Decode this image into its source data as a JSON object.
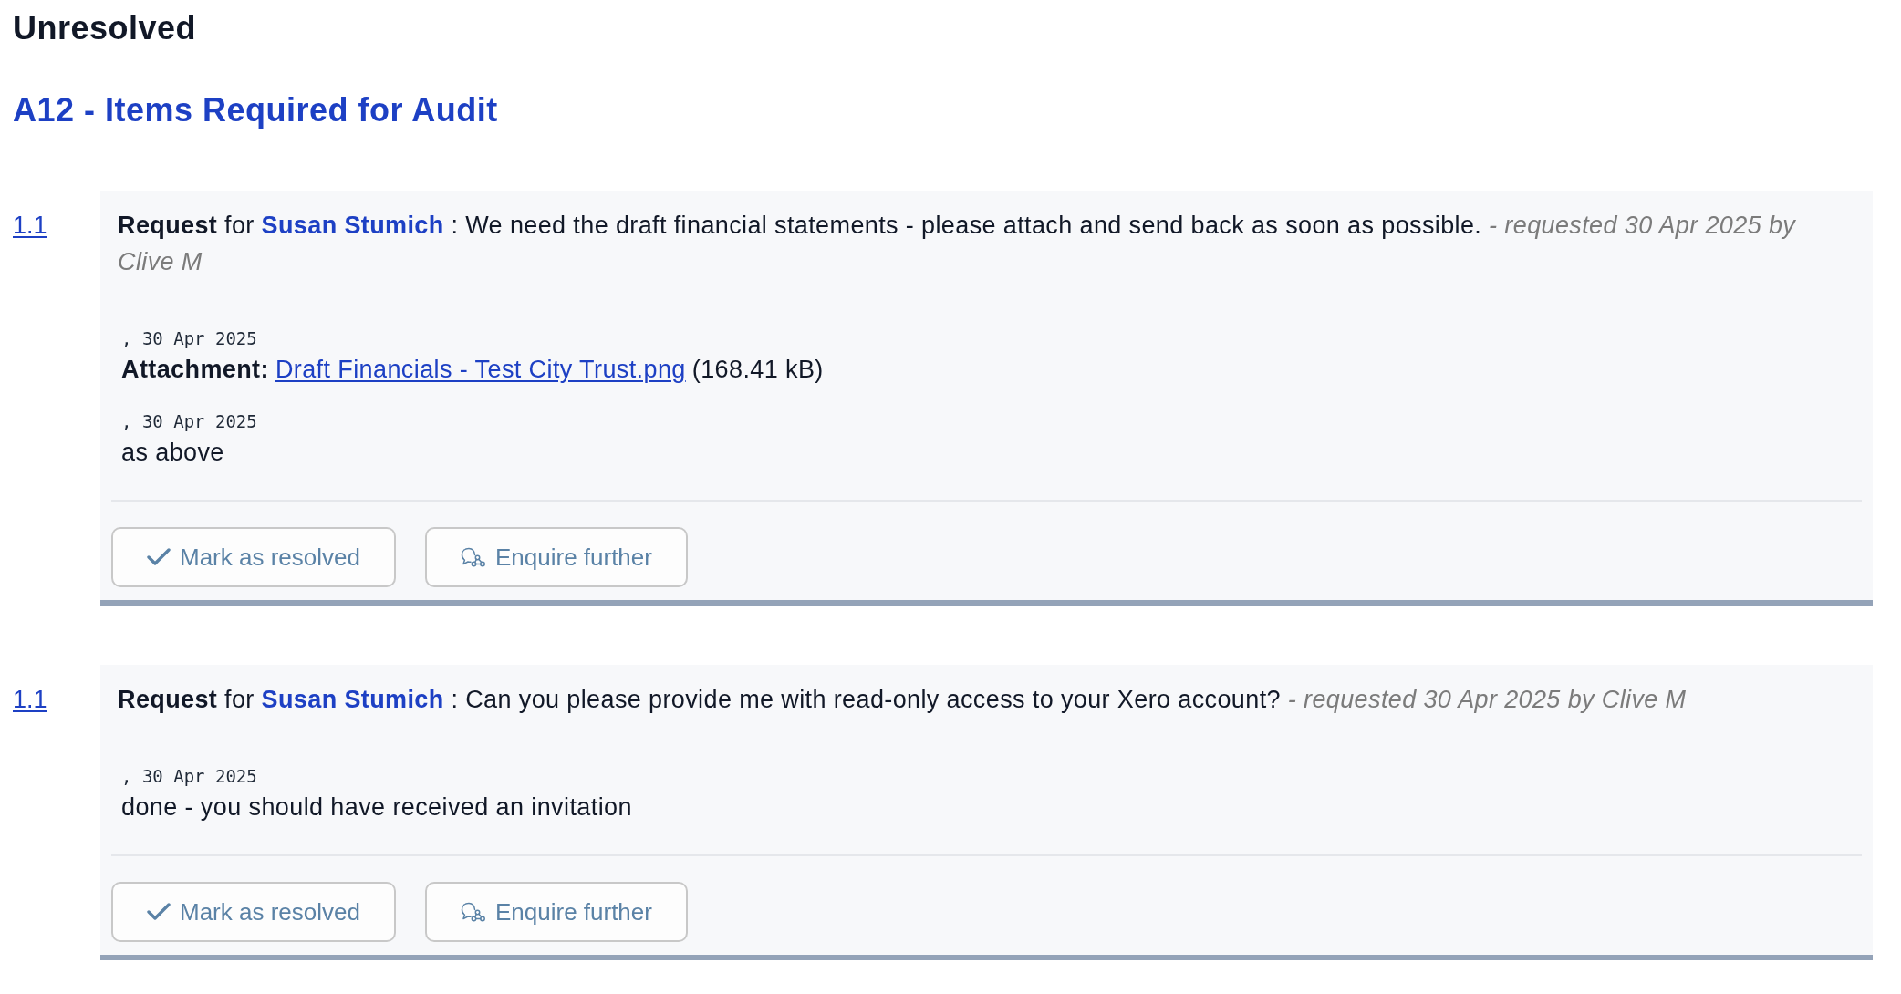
{
  "section_title": "Unresolved",
  "group_title": "A12 - Items Required for Audit",
  "requests": [
    {
      "number": "1.1",
      "label": "Request",
      "for_word": "for",
      "assignee": "Susan Stumich",
      "separator": ":",
      "text": "We need the draft financial statements - please attach and send back as soon as possible.",
      "meta": "- requested 30 Apr 2025 by Clive M",
      "responses": [
        {
          "kind": "attachment",
          "date": ", 30 Apr 2025",
          "label": "Attachment:",
          "file_name": "Draft Financials - Test City Trust.png",
          "file_size": "(168.41 kB)"
        },
        {
          "kind": "text",
          "date": ", 30 Apr 2025",
          "text": "as above"
        }
      ],
      "actions": [
        {
          "kind": "resolve",
          "label": "Mark as resolved"
        },
        {
          "kind": "enquire",
          "label": "Enquire further"
        }
      ]
    },
    {
      "number": "1.1",
      "label": "Request",
      "for_word": "for",
      "assignee": "Susan Stumich",
      "separator": ":",
      "text": "Can you please provide me with read-only access to your Xero account?",
      "meta": "- requested 30 Apr 2025 by Clive M",
      "responses": [
        {
          "kind": "text",
          "date": ", 30 Apr 2025",
          "text": "done - you should have received an invitation"
        }
      ],
      "actions": [
        {
          "kind": "resolve",
          "label": "Mark as resolved"
        },
        {
          "kind": "enquire",
          "label": "Enquire further"
        }
      ]
    }
  ]
}
